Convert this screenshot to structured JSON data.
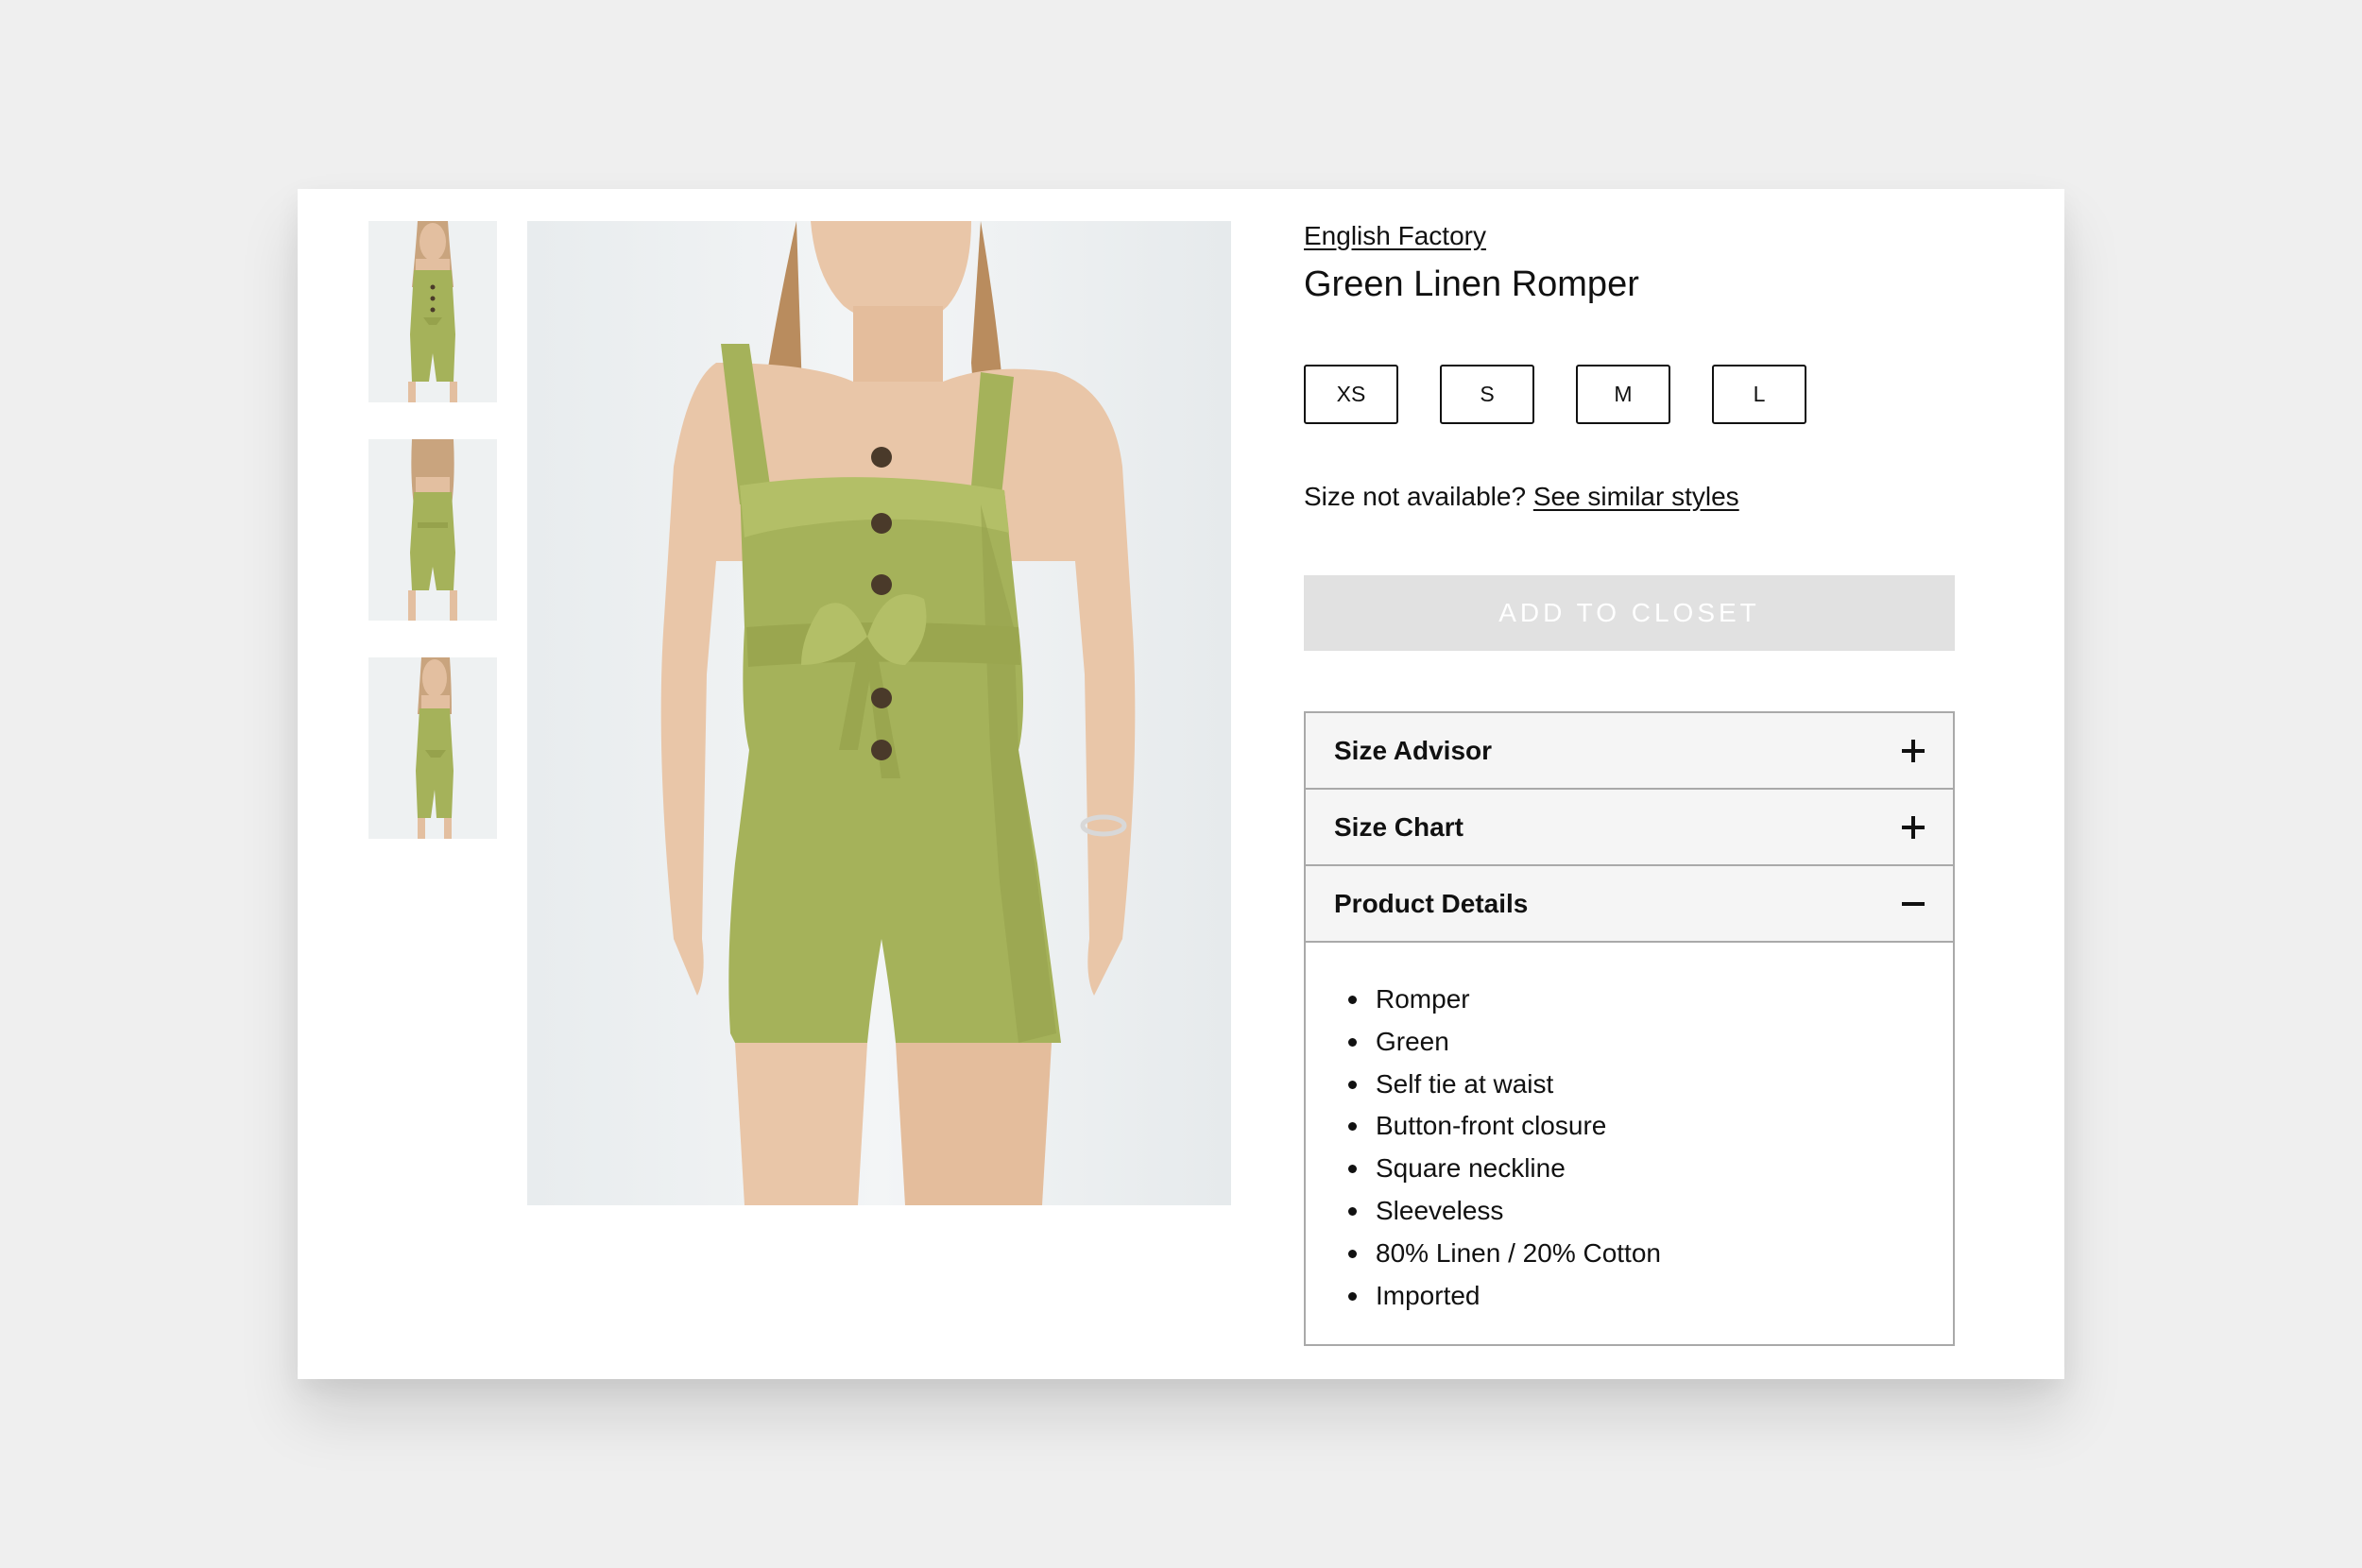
{
  "product": {
    "brand": "English Factory",
    "title": "Green Linen Romper",
    "color_hex": "#a5b25a"
  },
  "gallery": {
    "thumbnails": [
      {
        "icon": "romper-front-thumbnail"
      },
      {
        "icon": "romper-back-thumbnail"
      },
      {
        "icon": "romper-side-thumbnail"
      }
    ],
    "main_image_icon": "romper-model-photo"
  },
  "sizes": [
    "XS",
    "S",
    "M",
    "L"
  ],
  "size_note": {
    "text": "Size not available?",
    "link": "See similar styles"
  },
  "add_button": {
    "label": "ADD TO CLOSET",
    "state": "disabled"
  },
  "accordion": [
    {
      "label": "Size Advisor",
      "expanded": false,
      "icon": "plus-icon"
    },
    {
      "label": "Size Chart",
      "expanded": false,
      "icon": "plus-icon"
    },
    {
      "label": "Product Details",
      "expanded": true,
      "icon": "minus-icon"
    }
  ],
  "details": [
    "Romper",
    "Green",
    "Self tie at waist",
    "Button-front closure",
    "Square neckline",
    "Sleeveless",
    "80% Linen / 20% Cotton",
    "Imported"
  ],
  "colors": {
    "background": "#efefef",
    "button_disabled": "#e1e1e1",
    "accordion_header": "#f5f5f5",
    "border": "#a9a9a9"
  }
}
